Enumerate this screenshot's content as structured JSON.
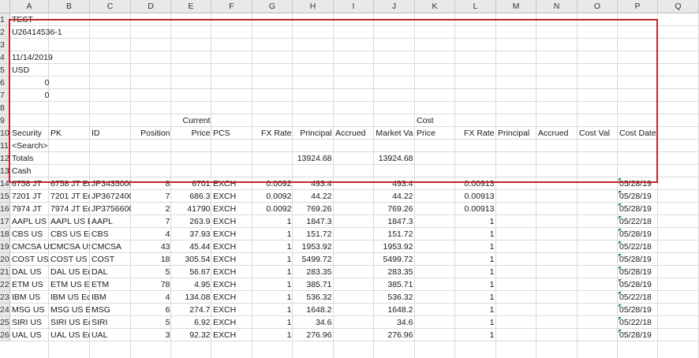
{
  "columns": [
    "A",
    "B",
    "C",
    "D",
    "E",
    "F",
    "G",
    "H",
    "I",
    "J",
    "K",
    "L",
    "M",
    "N",
    "O",
    "P",
    "Q"
  ],
  "rows": [
    {
      "label": "1",
      "cells": {
        "A": "TEST"
      }
    },
    {
      "label": "2",
      "cells": {
        "A": "U26414536-1"
      }
    },
    {
      "label": "3",
      "cells": {}
    },
    {
      "label": "4",
      "cells": {
        "A": "11/14/2019"
      }
    },
    {
      "label": "5",
      "cells": {
        "A": "USD"
      }
    },
    {
      "label": "6",
      "cells": {
        "A": "0"
      }
    },
    {
      "label": "7",
      "cells": {
        "A": "0"
      }
    },
    {
      "label": "8",
      "cells": {}
    },
    {
      "label": "9",
      "cells": {
        "E": "Current",
        "K": "Cost"
      }
    },
    {
      "label": "10",
      "cells": {
        "A": "Security",
        "B": "PK",
        "C": "ID",
        "D": "Position",
        "E": "Price",
        "F": "PCS",
        "G": "FX Rate",
        "H": "Principal",
        "I": "Accrued",
        "J": "Market Va",
        "K": "Price",
        "L": "FX Rate",
        "M": "Principal",
        "N": "Accrued",
        "O": "Cost Val",
        "P": "Cost Date"
      }
    },
    {
      "label": "11",
      "cells": {
        "A": "<Search>"
      }
    },
    {
      "label": "12",
      "cells": {
        "A": "Totals",
        "H": "13924.68",
        "J": "13924.68"
      }
    },
    {
      "label": "13",
      "cells": {
        "A": "Cash"
      }
    },
    {
      "label": "14",
      "cells": {
        "A": "6758 JT",
        "B": "6758 JT Eq",
        "C": "JP3435000",
        "D": "8",
        "E": "6701",
        "F": "EXCH",
        "G": "0.0092",
        "H": "493.4",
        "J": "493.4",
        "L": "0.00913",
        "P": "05/28/19"
      }
    },
    {
      "label": "15",
      "cells": {
        "A": "7201 JT",
        "B": "7201 JT Eq",
        "C": "JP3672400",
        "D": "7",
        "E": "686.3",
        "F": "EXCH",
        "G": "0.0092",
        "H": "44.22",
        "J": "44.22",
        "L": "0.00913",
        "P": "05/28/19"
      }
    },
    {
      "label": "16",
      "cells": {
        "A": "7974 JT",
        "B": "7974 JT Eq",
        "C": "JP3756600",
        "D": "2",
        "E": "41790",
        "F": "EXCH",
        "G": "0.0092",
        "H": "769.26",
        "J": "769.26",
        "L": "0.00913",
        "P": "05/28/19"
      }
    },
    {
      "label": "17",
      "cells": {
        "A": "AAPL US",
        "B": "AAPL US E",
        "C": "AAPL",
        "D": "7",
        "E": "263.9",
        "F": "EXCH",
        "G": "1",
        "H": "1847.3",
        "J": "1847.3",
        "L": "1",
        "P": "05/22/18"
      }
    },
    {
      "label": "18",
      "cells": {
        "A": "CBS US",
        "B": "CBS US Eq",
        "C": "CBS",
        "D": "4",
        "E": "37.93",
        "F": "EXCH",
        "G": "1",
        "H": "151.72",
        "J": "151.72",
        "L": "1",
        "P": "05/28/19"
      }
    },
    {
      "label": "19",
      "cells": {
        "A": "CMCSA US",
        "B": "CMCSA US",
        "C": "CMCSA",
        "D": "43",
        "E": "45.44",
        "F": "EXCH",
        "G": "1",
        "H": "1953.92",
        "J": "1953.92",
        "L": "1",
        "P": "05/22/18"
      }
    },
    {
      "label": "20",
      "cells": {
        "A": "COST US",
        "B": "COST US E",
        "C": "COST",
        "D": "18",
        "E": "305.54",
        "F": "EXCH",
        "G": "1",
        "H": "5499.72",
        "J": "5499.72",
        "L": "1",
        "P": "05/28/19"
      }
    },
    {
      "label": "21",
      "cells": {
        "A": "DAL US",
        "B": "DAL US Eq",
        "C": "DAL",
        "D": "5",
        "E": "56.67",
        "F": "EXCH",
        "G": "1",
        "H": "283.35",
        "J": "283.35",
        "L": "1",
        "P": "05/28/19"
      }
    },
    {
      "label": "22",
      "cells": {
        "A": "ETM US",
        "B": "ETM US Eq",
        "C": "ETM",
        "D": "78",
        "E": "4.95",
        "F": "EXCH",
        "G": "1",
        "H": "385.71",
        "J": "385.71",
        "L": "1",
        "P": "05/28/19"
      }
    },
    {
      "label": "23",
      "cells": {
        "A": "IBM US",
        "B": "IBM US Eq",
        "C": "IBM",
        "D": "4",
        "E": "134.08",
        "F": "EXCH",
        "G": "1",
        "H": "536.32",
        "J": "536.32",
        "L": "1",
        "P": "05/22/18"
      }
    },
    {
      "label": "24",
      "cells": {
        "A": "MSG US",
        "B": "MSG US Eq",
        "C": "MSG",
        "D": "6",
        "E": "274.7",
        "F": "EXCH",
        "G": "1",
        "H": "1648.2",
        "J": "1648.2",
        "L": "1",
        "P": "05/28/19"
      }
    },
    {
      "label": "25",
      "cells": {
        "A": "SIRI US",
        "B": "SIRI US Eq",
        "C": "SIRI",
        "D": "5",
        "E": "6.92",
        "F": "EXCH",
        "G": "1",
        "H": "34.6",
        "J": "34.6",
        "L": "1",
        "P": "05/22/18"
      }
    },
    {
      "label": "26",
      "cells": {
        "A": "UAL US",
        "B": "UAL US Eq",
        "C": "UAL",
        "D": "3",
        "E": "92.32",
        "F": "EXCH",
        "G": "1",
        "H": "276.96",
        "J": "276.96",
        "L": "1",
        "P": "05/28/19"
      }
    }
  ],
  "colors": {
    "highlight": "#c0272d",
    "header_bg": "#e9e9e9",
    "gridline": "#dadada",
    "comment_marker": "#1e8a3c"
  }
}
